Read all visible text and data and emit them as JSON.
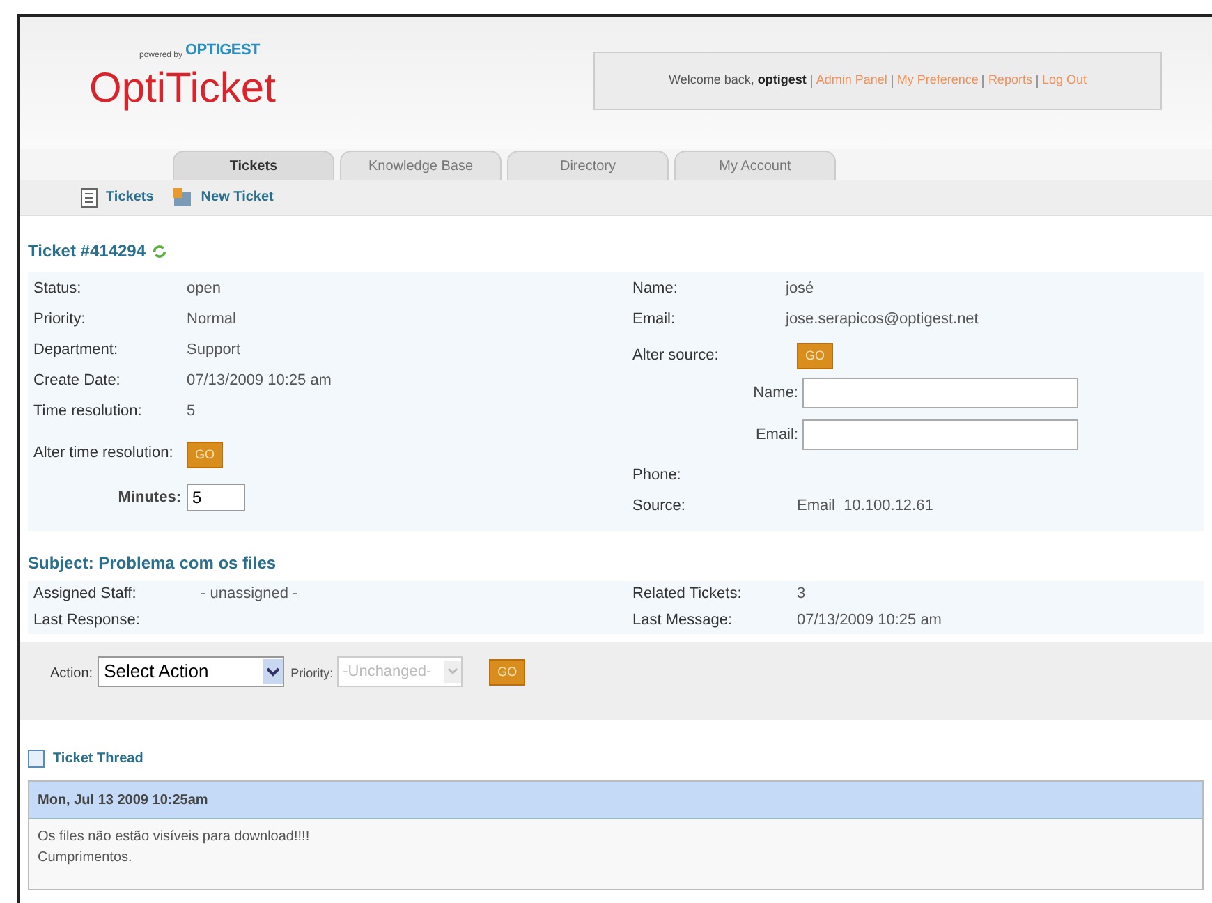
{
  "header": {
    "powered_by": "powered by",
    "brand": "OPTIGEST",
    "logo": "OptiTicket",
    "welcome": "Welcome back, ",
    "user": "optigest",
    "links": [
      "Admin Panel",
      "My Preference",
      "Reports",
      "Log Out"
    ]
  },
  "tabs": [
    {
      "label": "Tickets",
      "selected": true
    },
    {
      "label": "Knowledge Base",
      "selected": false
    },
    {
      "label": "Directory",
      "selected": false
    },
    {
      "label": "My Account",
      "selected": false
    }
  ],
  "subnav": [
    {
      "label": "Tickets",
      "kind": "list"
    },
    {
      "label": "New Ticket",
      "kind": "new"
    }
  ],
  "ticket": {
    "title": "Ticket #414294",
    "left": [
      {
        "label": "Status:",
        "value": "open"
      },
      {
        "label": "Priority:",
        "value": "Normal"
      },
      {
        "label": "Department:",
        "value": "Support"
      },
      {
        "label": "Create Date:",
        "value": "07/13/2009 10:25 am"
      },
      {
        "label": "Time resolution:",
        "value": "5"
      }
    ],
    "alter_time": {
      "label": "Alter time resolution:",
      "button": "GO",
      "minutes_label": "Minutes:",
      "minutes_value": "5"
    },
    "right": [
      {
        "label": "Name:",
        "value": "josé"
      },
      {
        "label": "Email:",
        "value": "jose.serapicos@optigest.net"
      }
    ],
    "alter_source": {
      "label": "Alter source:",
      "button": "GO",
      "name_label": "Name:",
      "email_label": "Email:"
    },
    "right_bottom": [
      {
        "label": "Phone:"
      },
      {
        "label": "Source:",
        "value": "Email  10.100.12.61"
      }
    ]
  },
  "subject": "Subject: Problema com os files",
  "meta": [
    {
      "label": "Assigned Staff:",
      "value": "- unassigned -",
      "label2": "Related Tickets:",
      "value2": "3"
    },
    {
      "label": "Last Response:",
      "label2": "Last Message:",
      "value2": "07/13/2009 10:25 am"
    }
  ],
  "action_bar": {
    "action_label": "Action:",
    "action_value": "Select Action",
    "priority_label": "Priority:",
    "priority_value": "-Unchanged-",
    "priority_disabled": true,
    "button": "GO"
  },
  "thread": {
    "title": "Ticket Thread",
    "date": "Mon, Jul 13 2009 10:25am",
    "lines": [
      "Os files não estão visíveis para download!!!!",
      "Cumprimentos."
    ]
  }
}
